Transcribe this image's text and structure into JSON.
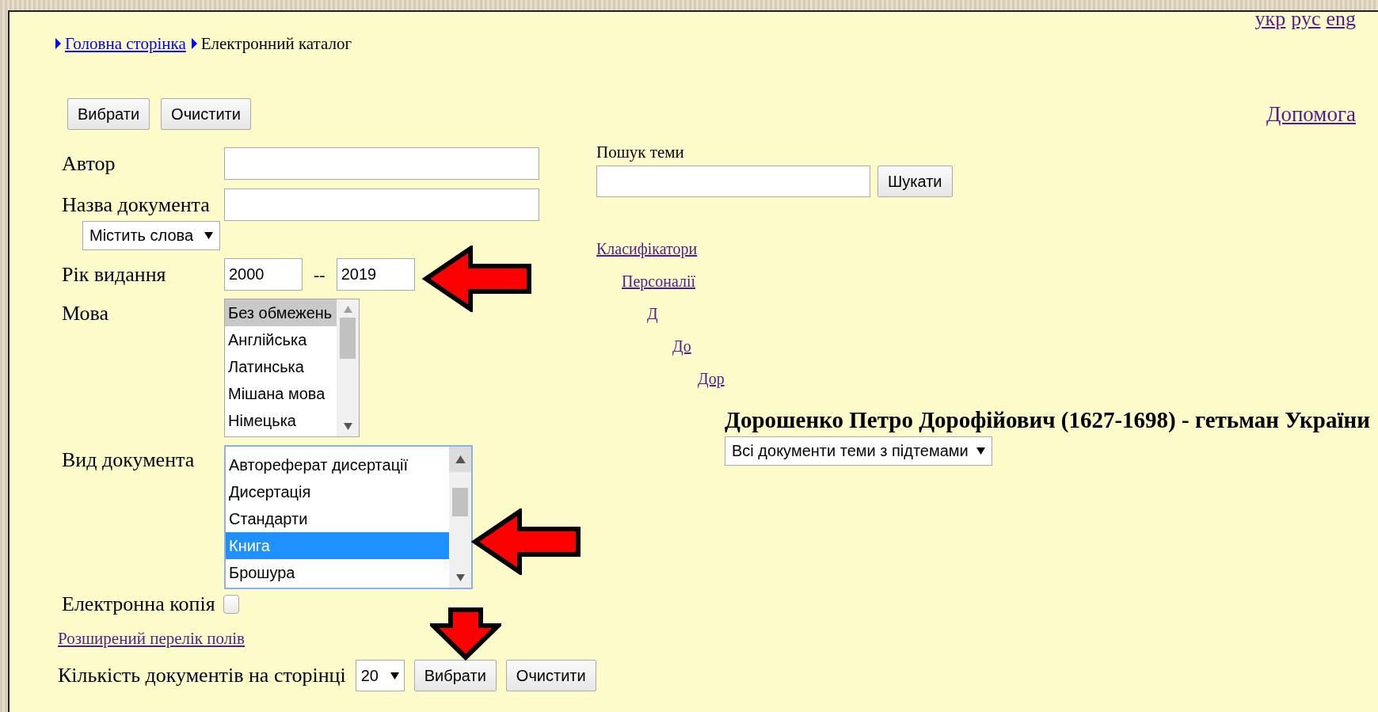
{
  "lang_links": [
    "укр",
    "рус",
    "eng"
  ],
  "breadcrumb": [
    {
      "label": "Головна сторінка",
      "kind": "link"
    },
    {
      "label": "Електронний каталог",
      "kind": "text"
    }
  ],
  "top_buttons": [
    "Вибрати",
    "Очистити"
  ],
  "help_link": "Допомога",
  "author": {
    "label": "Автор"
  },
  "title": {
    "label": "Назва документа",
    "match": "Містить слова"
  },
  "year": {
    "label": "Рік видання",
    "from": "2000",
    "separator": "--",
    "to": "2019"
  },
  "language": {
    "label": "Мова",
    "focused": false,
    "options": [
      {
        "label": "Без обмежень",
        "selected": true
      },
      {
        "label": "Англійська",
        "selected": false
      },
      {
        "label": "Латинська",
        "selected": false
      },
      {
        "label": "Мішана мова",
        "selected": false
      },
      {
        "label": "Німецька",
        "selected": false
      }
    ]
  },
  "doc_type": {
    "label": "Вид документа",
    "focused": true,
    "options": [
      {
        "label": "Автореферат дисертації",
        "selected": false
      },
      {
        "label": "Дисертація",
        "selected": false
      },
      {
        "label": "Стандарти",
        "selected": false
      },
      {
        "label": "Книга",
        "selected": true
      },
      {
        "label": "Брошура",
        "selected": false
      }
    ]
  },
  "electronic_copy": {
    "label": "Електронна копія",
    "checked": false
  },
  "extended_link": "Розширений перелік полів",
  "per_page": {
    "label": "Кількість документів на сторінці",
    "value": "20"
  },
  "bottom_buttons": [
    "Вибрати",
    "Очистити"
  ],
  "topic_search": {
    "label": "Пошук теми",
    "button": "Шукати"
  },
  "tree": [
    {
      "label": "Класифікатори",
      "children": [
        {
          "label": "Персоналії",
          "children": [
            {
              "label": "Д",
              "children": [
                {
                  "label": "До",
                  "children": [
                    {
                      "label": "Дор"
                    }
                  ]
                }
              ]
            }
          ]
        }
      ]
    }
  ],
  "topic": {
    "title": "Дорошенко Петро Дорофійович (1627-1698) - гетьман України",
    "scope": "Всі документи теми з підтемами"
  }
}
